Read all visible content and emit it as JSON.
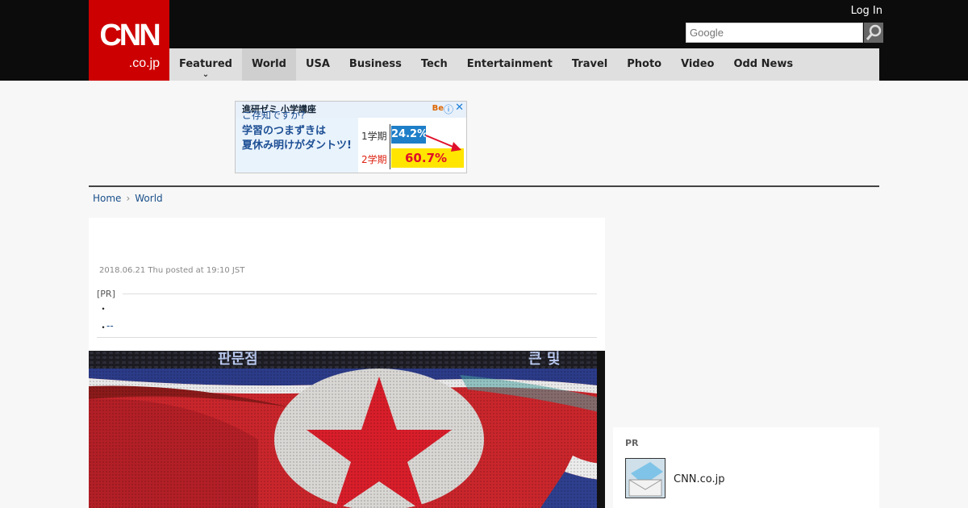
{
  "header": {
    "logo_main": "CNN",
    "logo_sub": ".co.jp",
    "login": "Log In",
    "search_placeholder": "Google"
  },
  "nav": {
    "items": [
      "Featured",
      "World",
      "USA",
      "Business",
      "Tech",
      "Entertainment",
      "Travel",
      "Photo",
      "Video",
      "Odd News"
    ],
    "active": "World",
    "dropdown_chevron": "chevron-down-icon"
  },
  "ad": {
    "title": "進研ゼミ 小学講座",
    "logo": "Be",
    "question": "ご存知ですか?",
    "line2": "学習のつまずきは",
    "line3": "夏休み明けがダントツ!",
    "term1_label": "1学期",
    "term1_value": "24.2%",
    "term2_label": "2学期",
    "term2_value": "60.7%",
    "info_icon": "info-icon",
    "close_icon": "close-icon"
  },
  "breadcrumb": {
    "home": "Home",
    "current": "World",
    "separator_icon": "chevron-right-icon"
  },
  "article": {
    "date": "2018.06.21 Thu posted at 19:10 JST",
    "pr_tag": "[PR]",
    "bullet": "・",
    "link_text": "--"
  },
  "sidebar": {
    "pr_label": "PR",
    "item_text": "CNN.co.jp"
  },
  "colors": {
    "brand_red": "#cc0000",
    "topbar": "#0c0c0c",
    "nav_bg": "#dfdfdf",
    "nav_active": "#cfcfcf",
    "link": "#1a4f8a"
  }
}
